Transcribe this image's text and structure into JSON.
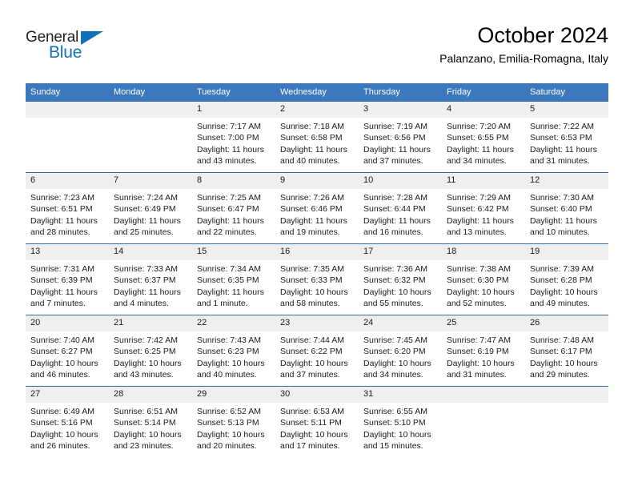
{
  "brand": {
    "name_part1": "General",
    "name_part2": "Blue",
    "triangle_icon": "triangle-icon",
    "accent_color": "#1271b8"
  },
  "header": {
    "title": "October 2024",
    "subtitle": "Palanzano, Emilia-Romagna, Italy"
  },
  "theme": {
    "header_row_bg": "#3b78be",
    "header_row_text": "#ffffff",
    "daynum_bg": "#efefef",
    "row_border": "#2f6eb5",
    "body_text": "#1a1a1a"
  },
  "weekday_headers": [
    "Sunday",
    "Monday",
    "Tuesday",
    "Wednesday",
    "Thursday",
    "Friday",
    "Saturday"
  ],
  "labels": {
    "sunrise_prefix": "Sunrise:",
    "sunset_prefix": "Sunset:",
    "daylight_prefix": "Daylight:"
  },
  "weeks": [
    [
      {
        "day": "",
        "empty": true
      },
      {
        "day": "",
        "empty": true
      },
      {
        "day": "1",
        "sunrise": "Sunrise: 7:17 AM",
        "sunset": "Sunset: 7:00 PM",
        "daylight": "Daylight: 11 hours and 43 minutes."
      },
      {
        "day": "2",
        "sunrise": "Sunrise: 7:18 AM",
        "sunset": "Sunset: 6:58 PM",
        "daylight": "Daylight: 11 hours and 40 minutes."
      },
      {
        "day": "3",
        "sunrise": "Sunrise: 7:19 AM",
        "sunset": "Sunset: 6:56 PM",
        "daylight": "Daylight: 11 hours and 37 minutes."
      },
      {
        "day": "4",
        "sunrise": "Sunrise: 7:20 AM",
        "sunset": "Sunset: 6:55 PM",
        "daylight": "Daylight: 11 hours and 34 minutes."
      },
      {
        "day": "5",
        "sunrise": "Sunrise: 7:22 AM",
        "sunset": "Sunset: 6:53 PM",
        "daylight": "Daylight: 11 hours and 31 minutes."
      }
    ],
    [
      {
        "day": "6",
        "sunrise": "Sunrise: 7:23 AM",
        "sunset": "Sunset: 6:51 PM",
        "daylight": "Daylight: 11 hours and 28 minutes."
      },
      {
        "day": "7",
        "sunrise": "Sunrise: 7:24 AM",
        "sunset": "Sunset: 6:49 PM",
        "daylight": "Daylight: 11 hours and 25 minutes."
      },
      {
        "day": "8",
        "sunrise": "Sunrise: 7:25 AM",
        "sunset": "Sunset: 6:47 PM",
        "daylight": "Daylight: 11 hours and 22 minutes."
      },
      {
        "day": "9",
        "sunrise": "Sunrise: 7:26 AM",
        "sunset": "Sunset: 6:46 PM",
        "daylight": "Daylight: 11 hours and 19 minutes."
      },
      {
        "day": "10",
        "sunrise": "Sunrise: 7:28 AM",
        "sunset": "Sunset: 6:44 PM",
        "daylight": "Daylight: 11 hours and 16 minutes."
      },
      {
        "day": "11",
        "sunrise": "Sunrise: 7:29 AM",
        "sunset": "Sunset: 6:42 PM",
        "daylight": "Daylight: 11 hours and 13 minutes."
      },
      {
        "day": "12",
        "sunrise": "Sunrise: 7:30 AM",
        "sunset": "Sunset: 6:40 PM",
        "daylight": "Daylight: 11 hours and 10 minutes."
      }
    ],
    [
      {
        "day": "13",
        "sunrise": "Sunrise: 7:31 AM",
        "sunset": "Sunset: 6:39 PM",
        "daylight": "Daylight: 11 hours and 7 minutes."
      },
      {
        "day": "14",
        "sunrise": "Sunrise: 7:33 AM",
        "sunset": "Sunset: 6:37 PM",
        "daylight": "Daylight: 11 hours and 4 minutes."
      },
      {
        "day": "15",
        "sunrise": "Sunrise: 7:34 AM",
        "sunset": "Sunset: 6:35 PM",
        "daylight": "Daylight: 11 hours and 1 minute."
      },
      {
        "day": "16",
        "sunrise": "Sunrise: 7:35 AM",
        "sunset": "Sunset: 6:33 PM",
        "daylight": "Daylight: 10 hours and 58 minutes."
      },
      {
        "day": "17",
        "sunrise": "Sunrise: 7:36 AM",
        "sunset": "Sunset: 6:32 PM",
        "daylight": "Daylight: 10 hours and 55 minutes."
      },
      {
        "day": "18",
        "sunrise": "Sunrise: 7:38 AM",
        "sunset": "Sunset: 6:30 PM",
        "daylight": "Daylight: 10 hours and 52 minutes."
      },
      {
        "day": "19",
        "sunrise": "Sunrise: 7:39 AM",
        "sunset": "Sunset: 6:28 PM",
        "daylight": "Daylight: 10 hours and 49 minutes."
      }
    ],
    [
      {
        "day": "20",
        "sunrise": "Sunrise: 7:40 AM",
        "sunset": "Sunset: 6:27 PM",
        "daylight": "Daylight: 10 hours and 46 minutes."
      },
      {
        "day": "21",
        "sunrise": "Sunrise: 7:42 AM",
        "sunset": "Sunset: 6:25 PM",
        "daylight": "Daylight: 10 hours and 43 minutes."
      },
      {
        "day": "22",
        "sunrise": "Sunrise: 7:43 AM",
        "sunset": "Sunset: 6:23 PM",
        "daylight": "Daylight: 10 hours and 40 minutes."
      },
      {
        "day": "23",
        "sunrise": "Sunrise: 7:44 AM",
        "sunset": "Sunset: 6:22 PM",
        "daylight": "Daylight: 10 hours and 37 minutes."
      },
      {
        "day": "24",
        "sunrise": "Sunrise: 7:45 AM",
        "sunset": "Sunset: 6:20 PM",
        "daylight": "Daylight: 10 hours and 34 minutes."
      },
      {
        "day": "25",
        "sunrise": "Sunrise: 7:47 AM",
        "sunset": "Sunset: 6:19 PM",
        "daylight": "Daylight: 10 hours and 31 minutes."
      },
      {
        "day": "26",
        "sunrise": "Sunrise: 7:48 AM",
        "sunset": "Sunset: 6:17 PM",
        "daylight": "Daylight: 10 hours and 29 minutes."
      }
    ],
    [
      {
        "day": "27",
        "sunrise": "Sunrise: 6:49 AM",
        "sunset": "Sunset: 5:16 PM",
        "daylight": "Daylight: 10 hours and 26 minutes."
      },
      {
        "day": "28",
        "sunrise": "Sunrise: 6:51 AM",
        "sunset": "Sunset: 5:14 PM",
        "daylight": "Daylight: 10 hours and 23 minutes."
      },
      {
        "day": "29",
        "sunrise": "Sunrise: 6:52 AM",
        "sunset": "Sunset: 5:13 PM",
        "daylight": "Daylight: 10 hours and 20 minutes."
      },
      {
        "day": "30",
        "sunrise": "Sunrise: 6:53 AM",
        "sunset": "Sunset: 5:11 PM",
        "daylight": "Daylight: 10 hours and 17 minutes."
      },
      {
        "day": "31",
        "sunrise": "Sunrise: 6:55 AM",
        "sunset": "Sunset: 5:10 PM",
        "daylight": "Daylight: 10 hours and 15 minutes."
      },
      {
        "day": "",
        "empty": true
      },
      {
        "day": "",
        "empty": true
      }
    ]
  ]
}
